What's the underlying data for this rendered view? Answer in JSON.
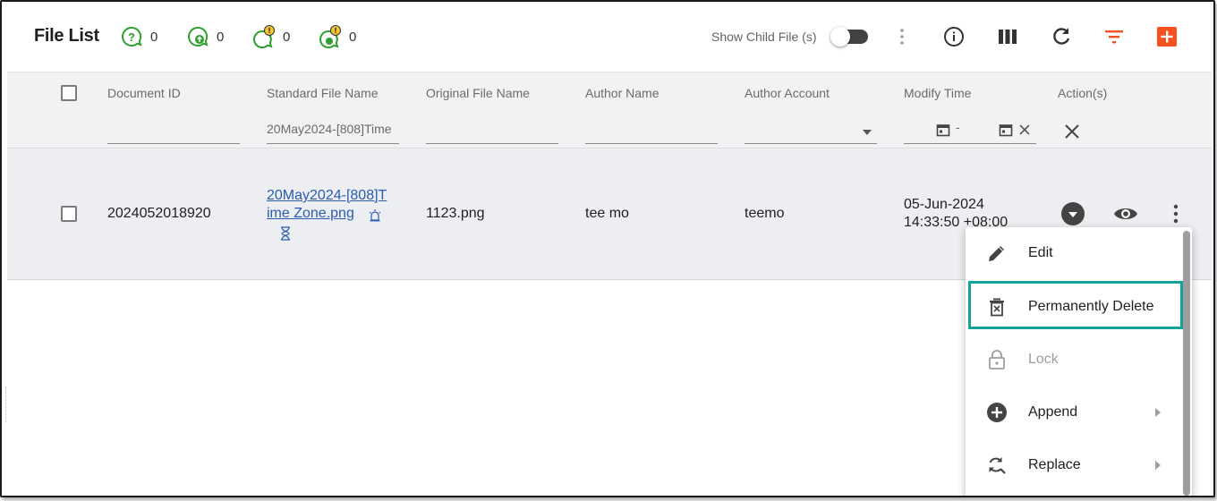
{
  "header": {
    "title": "File List",
    "counters": [
      {
        "icon": "question-chat-icon",
        "value": "0",
        "color": "#2e9e2e"
      },
      {
        "icon": "upload-chat-icon",
        "value": "0",
        "color": "#2e9e2e"
      },
      {
        "icon": "warning-chat-icon",
        "value": "0",
        "color": "#2e9e2e"
      },
      {
        "icon": "warning-upload-chat-icon",
        "value": "0",
        "color": "#2e9e2e"
      }
    ],
    "show_child_label": "Show Child File (s)",
    "show_child_on": false,
    "accent_color": "#f4511e"
  },
  "table": {
    "columns": [
      "Document ID",
      "Standard File Name",
      "Original File Name",
      "Author Name",
      "Author Account",
      "Modify Time",
      "Action(s)"
    ],
    "filters": {
      "standard_file_name": "20May2024-[808]Time",
      "date_from_sep": "-"
    },
    "rows": [
      {
        "document_id": "2024052018920",
        "standard_file_name_line1": "20May2024-[808]T",
        "standard_file_name_line2": "ime Zone.png",
        "original_file_name": "1123.png",
        "author_name": "tee mo",
        "author_account": "teemo",
        "modify_date": "05-Jun-2024",
        "modify_time": "14:33:50 +08:00"
      }
    ]
  },
  "menu": {
    "items": [
      {
        "label": "Edit",
        "icon": "pencil-icon",
        "disabled": false,
        "submenu": false
      },
      {
        "label": "Permanently Delete",
        "icon": "delete-box-icon",
        "disabled": false,
        "submenu": false
      },
      {
        "label": "Lock",
        "icon": "lock-icon",
        "disabled": true,
        "submenu": false
      },
      {
        "label": "Append",
        "icon": "plus-circle-icon",
        "disabled": false,
        "submenu": true
      },
      {
        "label": "Replace",
        "icon": "replace-icon",
        "disabled": false,
        "submenu": true
      }
    ],
    "highlight_color": "#15a39a"
  }
}
